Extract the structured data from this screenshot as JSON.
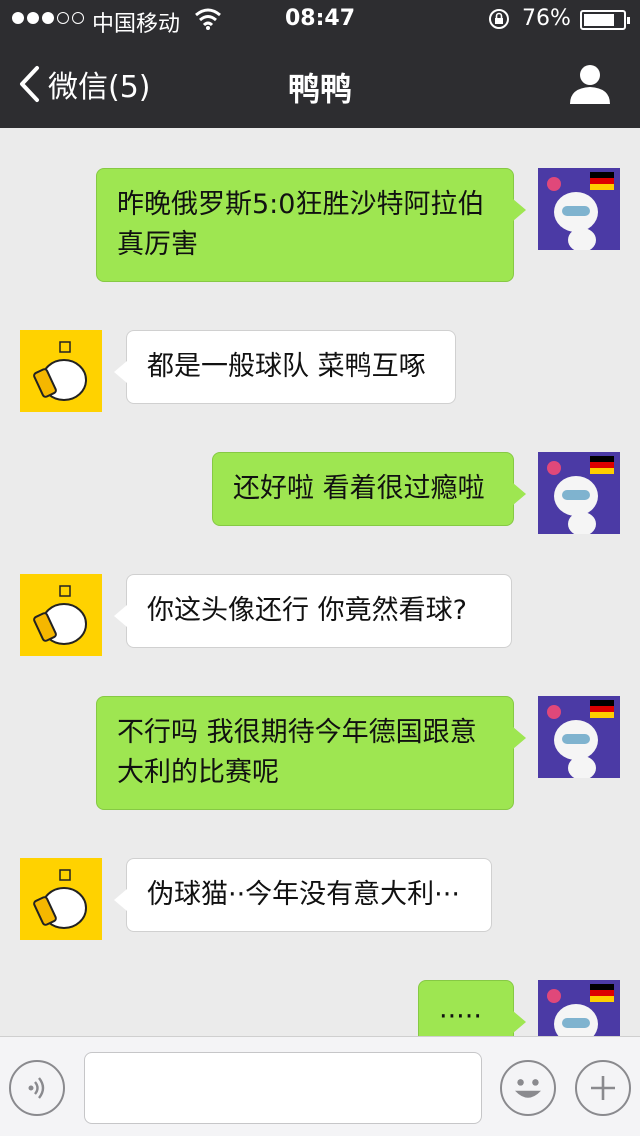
{
  "status": {
    "carrier": "中国移动",
    "time": "08:47",
    "battery_pct": "76%"
  },
  "nav": {
    "back_label": "微信(5)",
    "title": "鸭鸭"
  },
  "messages": [
    {
      "side": "sent",
      "text": "昨晚俄罗斯5:0狂胜沙特阿拉伯真厉害"
    },
    {
      "side": "recv",
      "text": "都是一般球队 菜鸭互啄"
    },
    {
      "side": "sent",
      "text": "还好啦 看着很过瘾啦"
    },
    {
      "side": "recv",
      "text": "你这头像还行 你竟然看球?"
    },
    {
      "side": "sent",
      "text": "不行吗 我很期待今年德国跟意大利的比赛呢"
    },
    {
      "side": "recv",
      "text": "伪球猫··今年没有意大利···"
    },
    {
      "side": "sent",
      "text": "·····"
    }
  ],
  "input": {
    "value": ""
  },
  "icons": {
    "back": "chevron-left-icon",
    "profile": "person-icon",
    "voice": "voice-icon",
    "emoji": "emoji-icon",
    "plus": "plus-icon"
  },
  "colors": {
    "nav_bg": "#2d2d30",
    "sent_bubble": "#9ee651",
    "recv_bubble": "#ffffff",
    "chat_bg": "#ebebeb"
  }
}
